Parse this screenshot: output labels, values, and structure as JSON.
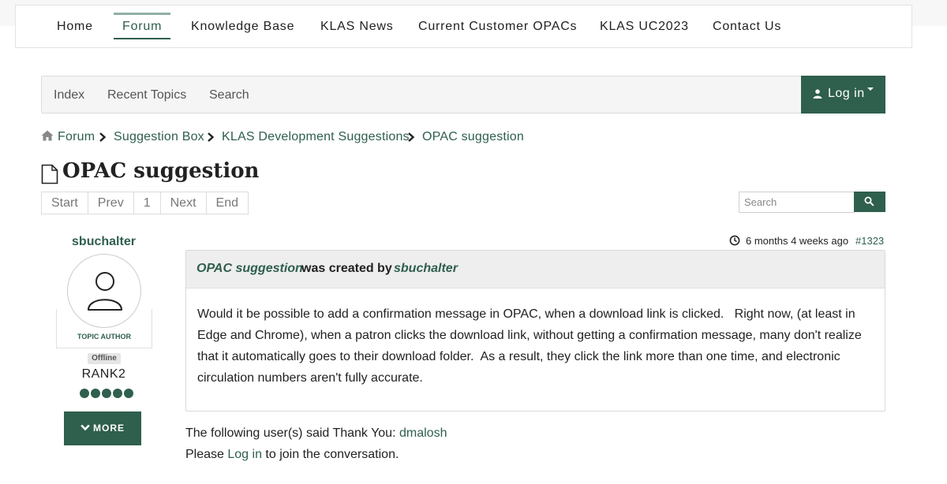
{
  "topnav": {
    "items": [
      {
        "label": "Home",
        "active": false
      },
      {
        "label": "Forum",
        "active": true
      },
      {
        "label": "Knowledge Base",
        "active": false
      },
      {
        "label": "KLAS News",
        "active": false
      },
      {
        "label": "Current Customer OPACs",
        "active": false
      },
      {
        "label": "KLAS UC2023",
        "active": false
      },
      {
        "label": "Contact Us",
        "active": false
      }
    ]
  },
  "subnav": {
    "items": [
      "Index",
      "Recent Topics",
      "Search"
    ],
    "login_label": "Log in"
  },
  "breadcrumb": [
    "Forum",
    "Suggestion Box",
    "KLAS Development Suggestions",
    "OPAC suggestion"
  ],
  "page": {
    "title": "OPAC suggestion"
  },
  "pagination": [
    "Start",
    "Prev",
    "1",
    "Next",
    "End"
  ],
  "search": {
    "placeholder": "Search"
  },
  "author": {
    "name": "sbuchalter",
    "role": "TOPIC AUTHOR",
    "status": "Offline",
    "rank": "RANK2",
    "rank_dots": 5,
    "more_label": "MORE"
  },
  "post": {
    "time": "6 months 4 weeks ago",
    "id": "#1323",
    "header_topic": "OPAC suggestion",
    "header_mid": "was created by",
    "header_user": "sbuchalter",
    "body": "Would it be possible to add a confirmation message in OPAC, when a download link is clicked.   Right now, (at least in Edge and Chrome), when a patron clicks the download link, without getting a confirmation message, many don't realize that it automatically goes to their download folder.  As a result, they click the link more than one time, and electronic circulation numbers aren't fully accurate."
  },
  "footer": {
    "thanks_prefix": "The following user(s) said Thank You:",
    "thanks_user": "dmalosh",
    "login_prefix": "Please",
    "login_link": "Log in",
    "login_suffix": "to join the conversation."
  },
  "colors": {
    "accent": "#2f5f4d",
    "subnav_bg": "#f5f5f5",
    "message_header_bg": "#eeeeee"
  }
}
